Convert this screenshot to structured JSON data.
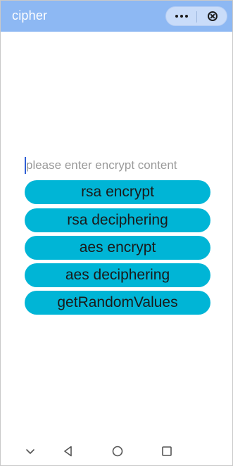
{
  "app": {
    "title": "cipher"
  },
  "capsule": {
    "more_icon": "more-dots-icon",
    "close_icon": "close-circle-icon"
  },
  "form": {
    "input_placeholder": "please enter encrypt content",
    "input_value": ""
  },
  "buttons": [
    {
      "label": "rsa encrypt"
    },
    {
      "label": "rsa deciphering"
    },
    {
      "label": "aes encrypt"
    },
    {
      "label": "aes deciphering"
    },
    {
      "label": "getRandomValues"
    }
  ],
  "navbar": {
    "icons": [
      "chevron-down-icon",
      "back-triangle-icon",
      "home-circle-icon",
      "recent-square-icon"
    ]
  },
  "colors": {
    "titlebar": "#8db8f3",
    "button": "#00b5d6",
    "caret": "#2f5fd6"
  }
}
